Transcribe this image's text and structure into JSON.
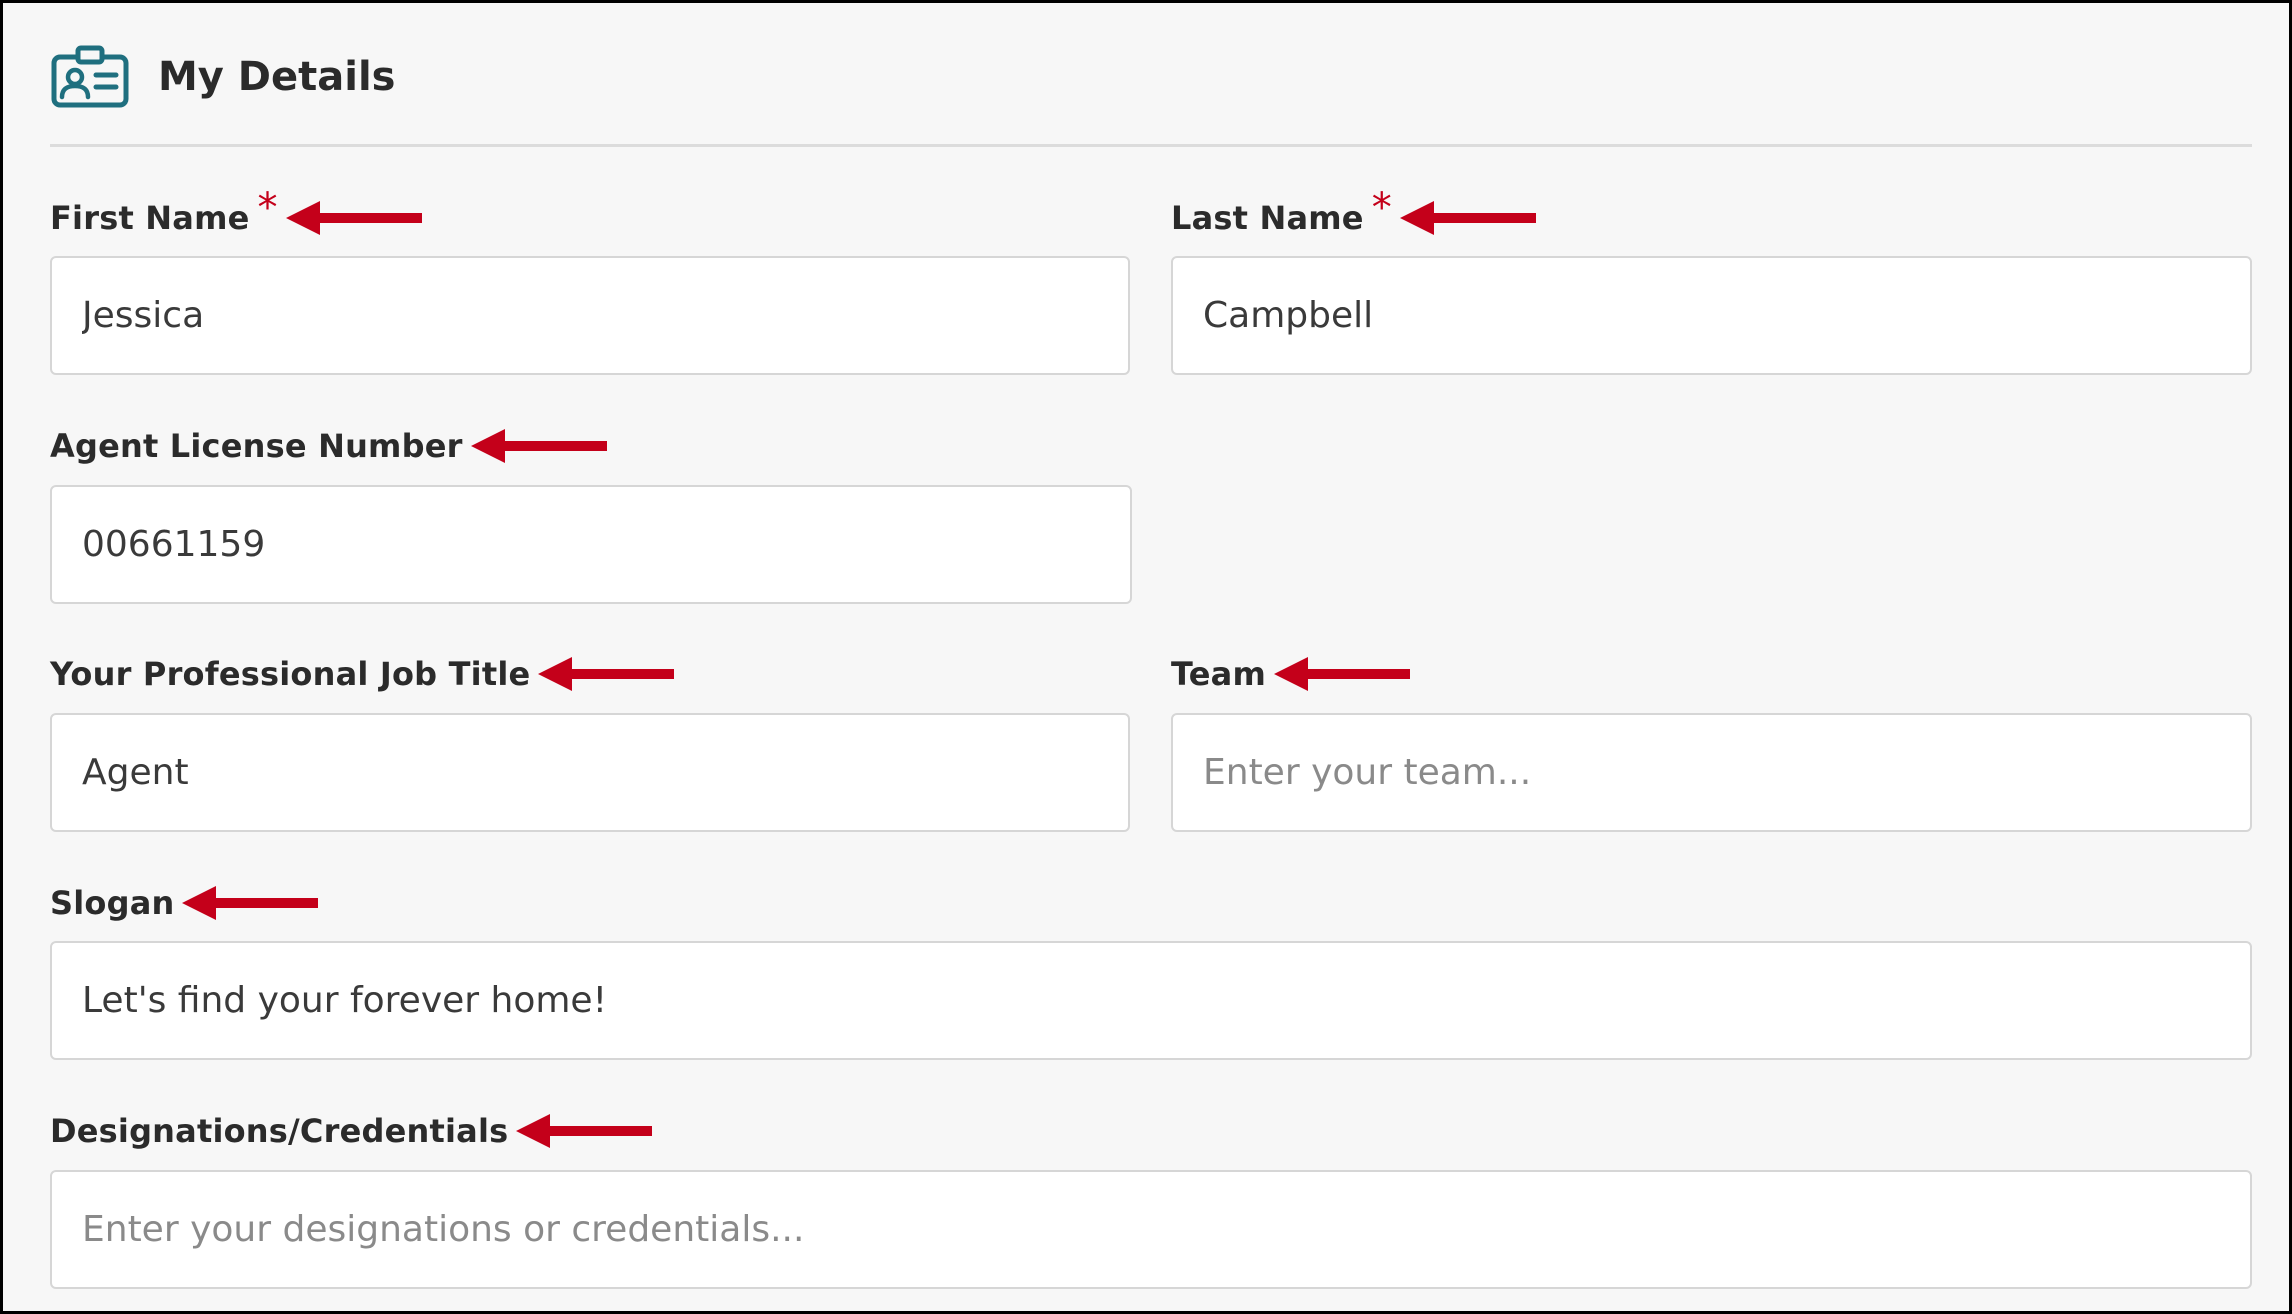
{
  "header": {
    "title": "My Details",
    "icon": "id-badge-icon",
    "icon_color": "#1f6f7f"
  },
  "annotation_color": "#c4001a",
  "fields": {
    "first_name": {
      "label": "First Name",
      "required_mark": "*",
      "value": "Jessica",
      "placeholder": ""
    },
    "last_name": {
      "label": "Last Name",
      "required_mark": "*",
      "value": "Campbell",
      "placeholder": ""
    },
    "license": {
      "label": "Agent License Number",
      "value": "00661159",
      "placeholder": ""
    },
    "job_title": {
      "label": "Your Professional Job Title",
      "value": "Agent",
      "placeholder": ""
    },
    "team": {
      "label": "Team",
      "value": "",
      "placeholder": "Enter your team..."
    },
    "slogan": {
      "label": "Slogan",
      "value": "Let's find your forever home!",
      "placeholder": ""
    },
    "designations": {
      "label": "Designations/Credentials",
      "value": "",
      "placeholder": "Enter your designations or credentials..."
    }
  }
}
